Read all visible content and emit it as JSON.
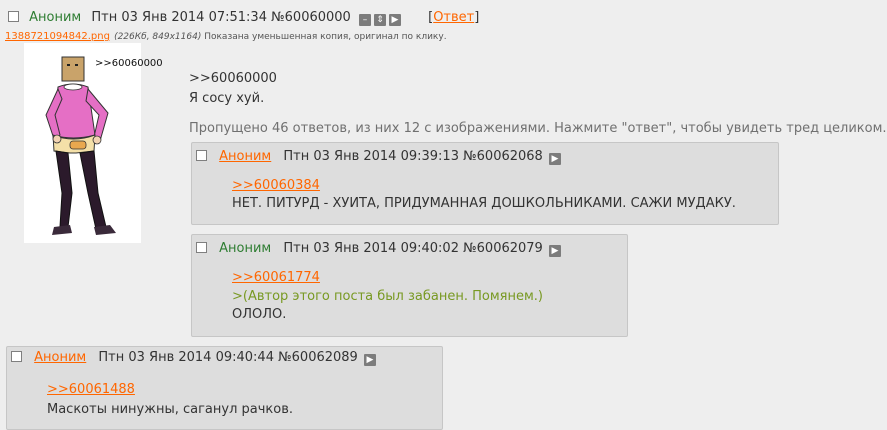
{
  "op": {
    "name": "Аноним",
    "date": "Птн 03 Янв 2014 07:51:34",
    "postnum": "№60060000",
    "reply_label": "Ответ",
    "file": {
      "filename": "1388721094842.png",
      "meta": "(226Кб, 849x1164)",
      "note": "Показана уменьшенная копия, оригинал по клику.",
      "thumb_caption": ">>60060000"
    },
    "ref": ">>60060000",
    "text": "Я сосу хуй.",
    "omitted": "Пропущено 46 ответов, из них 12 с изображениями. Нажмите \"ответ\", чтобы увидеть тред целиком."
  },
  "replies": [
    {
      "name": "Аноним",
      "date": "Птн 03 Янв 2014 09:39:13",
      "postnum": "№60062068",
      "ref": ">>60060384",
      "text": "НЕТ. ПИТУРД - ХУИТА, ПРИДУМАННАЯ ДОШКОЛЬНИКАМИ. САЖИ МУДАКУ."
    },
    {
      "name": "Аноним",
      "date": "Птн 03 Янв 2014 09:40:02",
      "postnum": "№60062079",
      "ref": ">>60061774",
      "greentext": ">(Автор этого поста был забанен. Помянем.)",
      "text": "ОЛОЛО."
    },
    {
      "name": "Аноним",
      "date": "Птн 03 Янв 2014 09:40:44",
      "postnum": "№60062089",
      "ref": ">>60061488",
      "text": "Маскоты нинужны, саганул рачков."
    }
  ],
  "icons": {
    "hide": "minus-icon",
    "expand": "expand-icon",
    "play": "play-icon"
  }
}
